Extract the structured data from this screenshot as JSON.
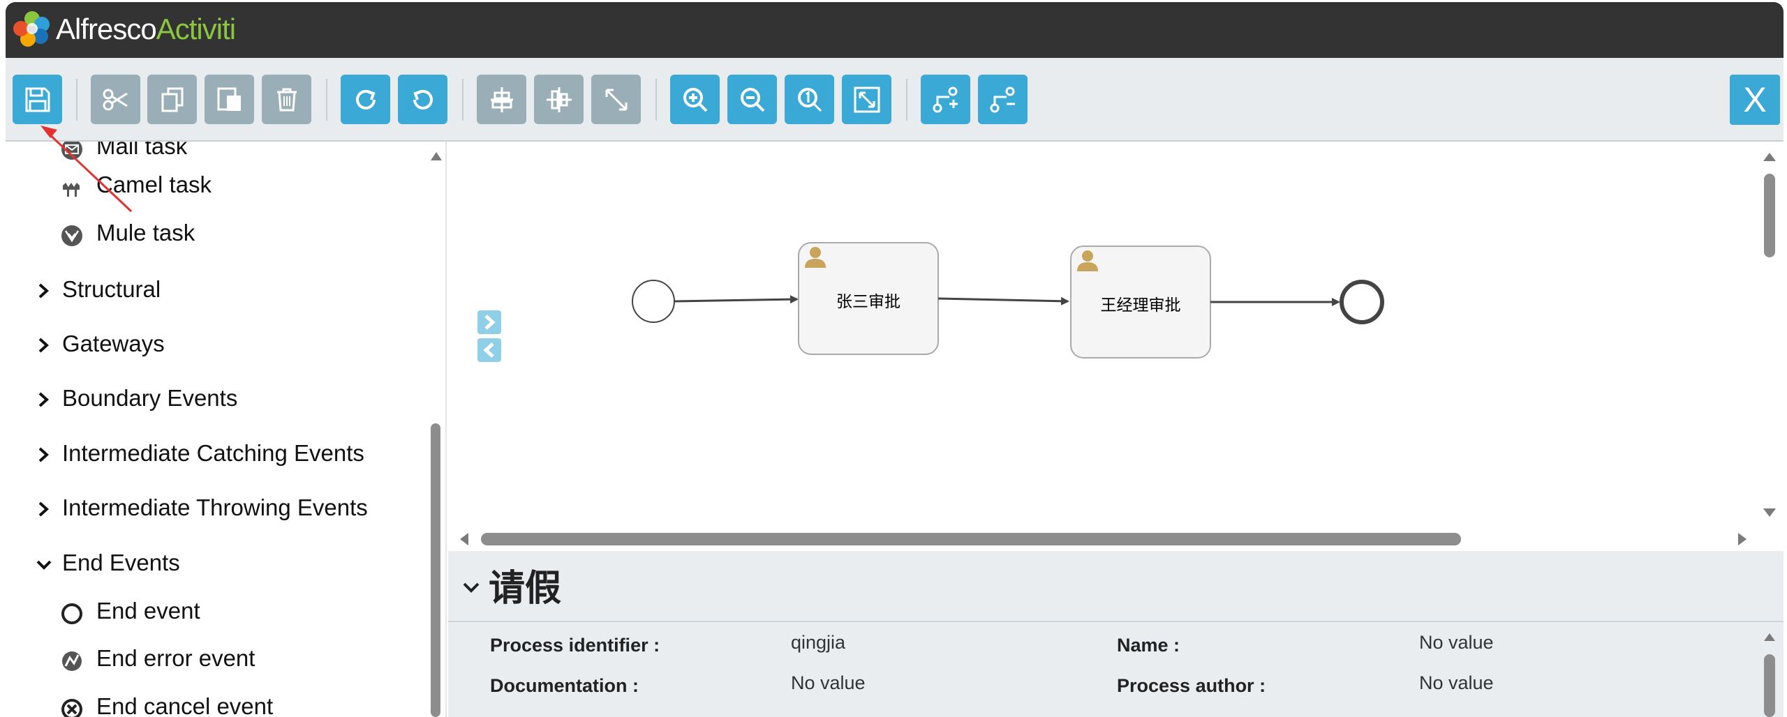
{
  "app": {
    "logo_text_1": "Alfresco",
    "logo_text_2": "Activiti",
    "logo_icon": "alfresco-flower-icon"
  },
  "toolbar": {
    "buttons": [
      {
        "name": "save",
        "icon": "save-icon",
        "enabled": true
      },
      {
        "name": "cut",
        "icon": "scissors-icon",
        "enabled": false
      },
      {
        "name": "copy",
        "icon": "copy-icon",
        "enabled": false
      },
      {
        "name": "paste",
        "icon": "paste-icon",
        "enabled": false
      },
      {
        "name": "delete",
        "icon": "trash-icon",
        "enabled": false
      },
      {
        "name": "redo",
        "icon": "redo-icon",
        "enabled": true
      },
      {
        "name": "undo",
        "icon": "undo-icon",
        "enabled": true
      },
      {
        "name": "align-vertical",
        "icon": "align-vertical-icon",
        "enabled": false
      },
      {
        "name": "align-horizontal",
        "icon": "align-horizontal-icon",
        "enabled": false
      },
      {
        "name": "same-size",
        "icon": "same-size-icon",
        "enabled": false
      },
      {
        "name": "zoom-in",
        "icon": "zoom-in-icon",
        "enabled": true
      },
      {
        "name": "zoom-out",
        "icon": "zoom-out-icon",
        "enabled": true
      },
      {
        "name": "zoom-actual",
        "icon": "zoom-actual-icon",
        "enabled": true
      },
      {
        "name": "zoom-fit",
        "icon": "zoom-fit-icon",
        "enabled": true
      },
      {
        "name": "add-bendpoint",
        "icon": "add-bendpoint-icon",
        "enabled": true
      },
      {
        "name": "remove-bendpoint",
        "icon": "remove-bendpoint-icon",
        "enabled": true
      }
    ],
    "close_label": "X",
    "colors": {
      "active": "#3aa9d6",
      "inactive": "#9aaeb8"
    }
  },
  "palette": {
    "items": [
      {
        "type": "task",
        "label": "Mail task",
        "icon": "mail-icon"
      },
      {
        "type": "task",
        "label": "Camel task",
        "icon": "camel-icon"
      },
      {
        "type": "task",
        "label": "Mule task",
        "icon": "mule-icon"
      },
      {
        "type": "category",
        "label": "Structural",
        "expanded": false
      },
      {
        "type": "category",
        "label": "Gateways",
        "expanded": false
      },
      {
        "type": "category",
        "label": "Boundary Events",
        "expanded": false
      },
      {
        "type": "category",
        "label": "Intermediate Catching Events",
        "expanded": false
      },
      {
        "type": "category",
        "label": "Intermediate Throwing Events",
        "expanded": false
      },
      {
        "type": "category",
        "label": "End Events",
        "expanded": true
      },
      {
        "type": "event",
        "label": "End event",
        "icon": "end-event-icon"
      },
      {
        "type": "event",
        "label": "End error event",
        "icon": "end-error-event-icon"
      },
      {
        "type": "event",
        "label": "End cancel event",
        "icon": "end-cancel-event-icon"
      }
    ]
  },
  "diagram": {
    "tasks": [
      {
        "label": "张三审批",
        "icon": "user-icon"
      },
      {
        "label": "王经理审批",
        "icon": "user-icon"
      }
    ]
  },
  "properties": {
    "title": "请假",
    "fields": [
      {
        "label": "Process identifier :",
        "value": "qingjia"
      },
      {
        "label": "Name :",
        "value": "No value"
      },
      {
        "label": "Documentation :",
        "value": "No value"
      },
      {
        "label": "Process author :",
        "value": "No value"
      }
    ]
  }
}
